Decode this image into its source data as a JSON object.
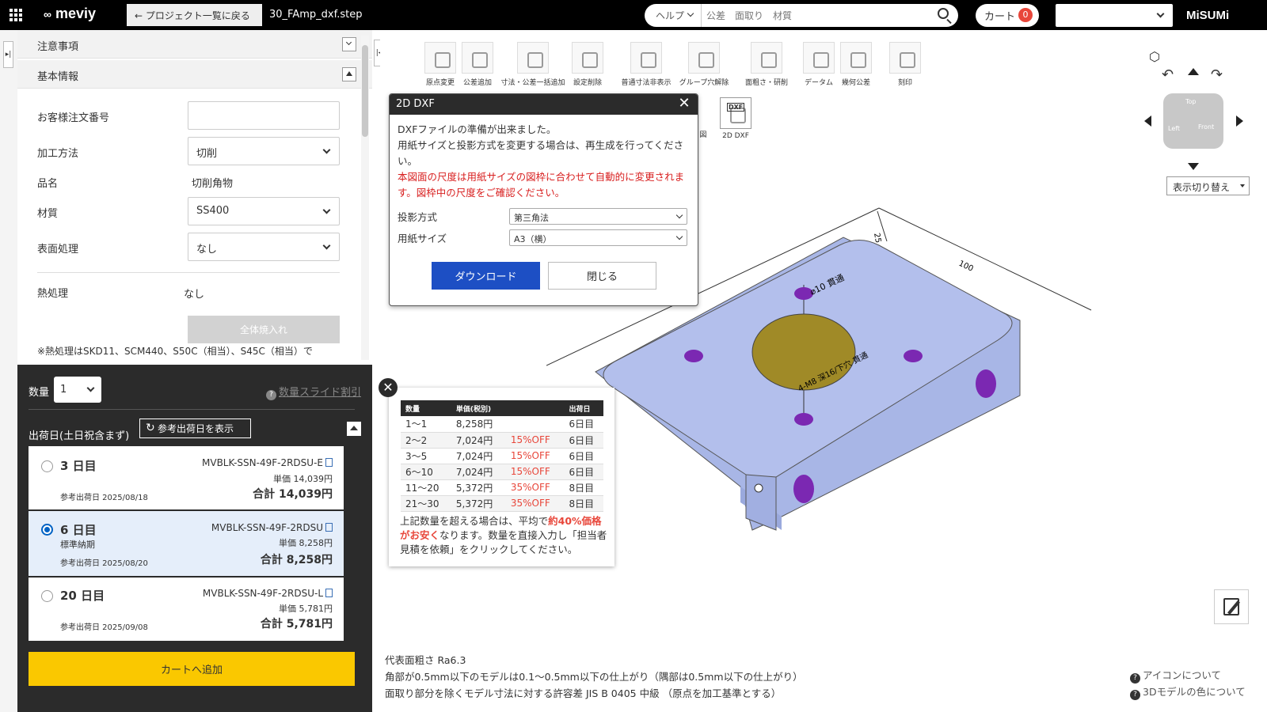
{
  "topbar": {
    "logo": "meviy",
    "back_label": "← プロジェクト一覧に戻る",
    "file_name": "30_FAmp_dxf.step",
    "search_category": "ヘルプ",
    "search_placeholder": "公差　面取り　材質",
    "cart_label": "カート",
    "cart_count": "0",
    "brand": "MiSUMi"
  },
  "left": {
    "notes_header": "注意事項",
    "basic_header": "基本情報",
    "order_no_label": "お客様注文番号",
    "order_no_value": "",
    "method_label": "加工方法",
    "method_value": "切削",
    "product_label": "品名",
    "product_value": "切削角物",
    "material_label": "材質",
    "material_value": "SS400",
    "surface_label": "表面処理",
    "surface_value": "なし",
    "heat_label": "熱処理",
    "heat_value": "なし",
    "heat_button": "全体焼入れ",
    "heat_note": "※熱処理はSKD11、SCM440、S50C（相当）、S45C（相当）で"
  },
  "order": {
    "qty_label": "数量",
    "qty_value": "1",
    "slide_link": "数量スライド割引",
    "ship_label": "出荷日(土日祝含まず)",
    "ref_button": "参考出荷日を表示",
    "options": [
      {
        "days": "3 日目",
        "code": "MVBLK-SSN-49F-2RDSU-E",
        "unit": "単価 14,039円",
        "total": "合計 14,039円",
        "date": "参考出荷日 2025/08/18",
        "std": "",
        "selected": false
      },
      {
        "days": "6 日目",
        "code": "MVBLK-SSN-49F-2RDSU",
        "unit": "単価 8,258円",
        "total": "合計 8,258円",
        "date": "参考出荷日 2025/08/20",
        "std": "標準納期",
        "selected": true
      },
      {
        "days": "20 日目",
        "code": "MVBLK-SSN-49F-2RDSU-L",
        "unit": "単価 5,781円",
        "total": "合計 5,781円",
        "date": "参考出荷日 2025/09/08",
        "std": "",
        "selected": false
      }
    ],
    "cart_button": "カートへ追加"
  },
  "toolbar": {
    "tools": [
      "原点変更",
      "公差追加",
      "寸法・公差一括追加",
      "設定削除",
      "普通寸法非表示",
      "グループ穴解除",
      "面粗さ・研削",
      "データム",
      "幾何公差",
      "刻印"
    ],
    "tools2_partial": "図",
    "dxf_tool": "2D DXF",
    "dxf_badge": "DXF"
  },
  "dialog": {
    "title": "2D DXF",
    "line1": "DXFファイルの準備が出来ました。",
    "line2": "用紙サイズと投影方式を変更する場合は、再生成を行ってください。",
    "warning": "本図面の尺度は用紙サイズの図枠に合わせて自動的に変更されます。図枠中の尺度をご確認ください。",
    "proj_label": "投影方式",
    "proj_value": "第三角法",
    "paper_label": "用紙サイズ",
    "paper_value": "A3（横）",
    "download": "ダウンロード",
    "close": "閉じる"
  },
  "price_table": {
    "headers": [
      "数量",
      "単価(税別)",
      "",
      "出荷日"
    ],
    "rows": [
      [
        "1～1",
        "8,258円",
        "",
        "6日目"
      ],
      [
        "2～2",
        "7,024円",
        "15%OFF",
        "6日目"
      ],
      [
        "3～5",
        "7,024円",
        "15%OFF",
        "6日目"
      ],
      [
        "6～10",
        "7,024円",
        "15%OFF",
        "6日目"
      ],
      [
        "11～20",
        "5,372円",
        "35%OFF",
        "8日目"
      ],
      [
        "21～30",
        "5,372円",
        "35%OFF",
        "8日目"
      ]
    ],
    "note_pre": "上記数量を超える場合は、平均で",
    "note_red": "約40%価格がお安く",
    "note_post": "なります。数量を直接入力し「担当者見積を依頼」をクリックしてください。",
    "close_glyph": "✕"
  },
  "model": {
    "dim_100": "100",
    "dim_25": "25",
    "label_hole1": "⌀10 貫通",
    "label_hole2": "4-M8 深16/下穴 貫通",
    "nav_cube_top": "Top",
    "nav_cube_left": "Left",
    "nav_cube_front": "Front",
    "view_switch": "表示切り替え",
    "colors": {
      "body": "#b0bdea",
      "hole_gold": "#a08a27",
      "hole_purple": "#7b28b2"
    }
  },
  "footer": {
    "line1": "代表面粗さ Ra6.3",
    "line2": "角部が0.5mm以下のモデルは0.1～0.5mm以下の仕上がり（隅部は0.5mm以下の仕上がり）",
    "line3": "面取り部分を除くモデル寸法に対する許容差 JIS B 0405 中級 （原点を加工基準とする）",
    "help1": "アイコンについて",
    "help2": "3Dモデルの色について"
  }
}
